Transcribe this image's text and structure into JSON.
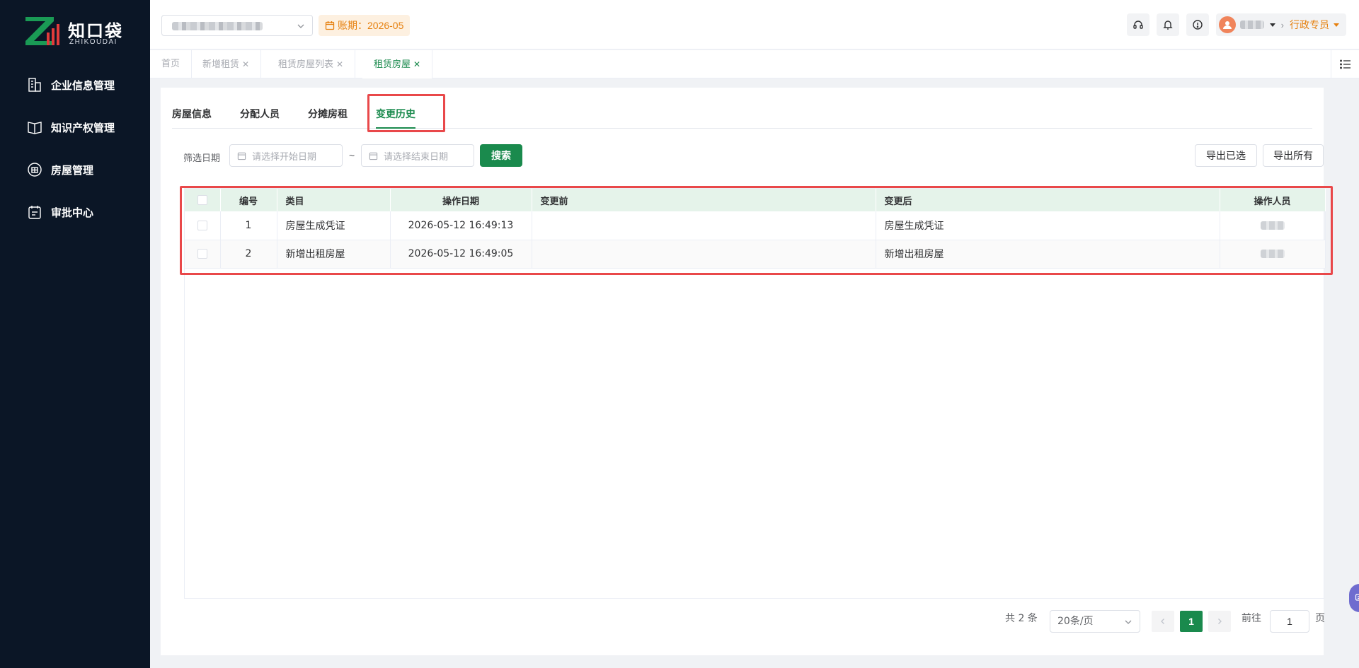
{
  "sidebar": {
    "logo_cn": "知口袋",
    "logo_en": "ZHIKOUDAI",
    "items": [
      {
        "label": "企业信息管理",
        "icon": "building-icon"
      },
      {
        "label": "知识产权管理",
        "icon": "book-icon"
      },
      {
        "label": "房屋管理",
        "icon": "house-icon"
      },
      {
        "label": "审批中心",
        "icon": "approval-icon"
      }
    ]
  },
  "header": {
    "period_label": "账期：2026-05",
    "role": "行政专员"
  },
  "page_tabs": [
    {
      "label": "首页",
      "closable": false
    },
    {
      "label": "新增租赁",
      "closable": true
    },
    {
      "label": "租赁房屋列表",
      "closable": true
    },
    {
      "label": "租赁房屋",
      "closable": true,
      "active": true
    }
  ],
  "sub_tabs": [
    "房屋信息",
    "分配人员",
    "分摊房租",
    "变更历史"
  ],
  "filter": {
    "label": "筛选日期",
    "start_placeholder": "请选择开始日期",
    "separator": "~",
    "end_placeholder": "请选择结束日期",
    "search": "搜索",
    "export_selected": "导出已选",
    "export_all": "导出所有"
  },
  "table": {
    "columns": [
      "编号",
      "类目",
      "操作日期",
      "变更前",
      "变更后",
      "操作人员"
    ],
    "rows": [
      {
        "no": "1",
        "category": "房屋生成凭证",
        "date": "2026-05-12 16:49:13",
        "before": "",
        "after": "房屋生成凭证"
      },
      {
        "no": "2",
        "category": "新增出租房屋",
        "date": "2026-05-12 16:49:05",
        "before": "",
        "after": "新增出租房屋"
      }
    ]
  },
  "pagination": {
    "total": "共 2 条",
    "page_size": "20条/页",
    "current_page": "1",
    "goto_label": "前往",
    "goto_value": "1",
    "page_suffix": "页"
  },
  "colors": {
    "brand_green": "#1a8a4d",
    "sidebar_bg": "#0b1626",
    "accent_orange": "#e6800e",
    "highlight_red": "#e9484a"
  }
}
